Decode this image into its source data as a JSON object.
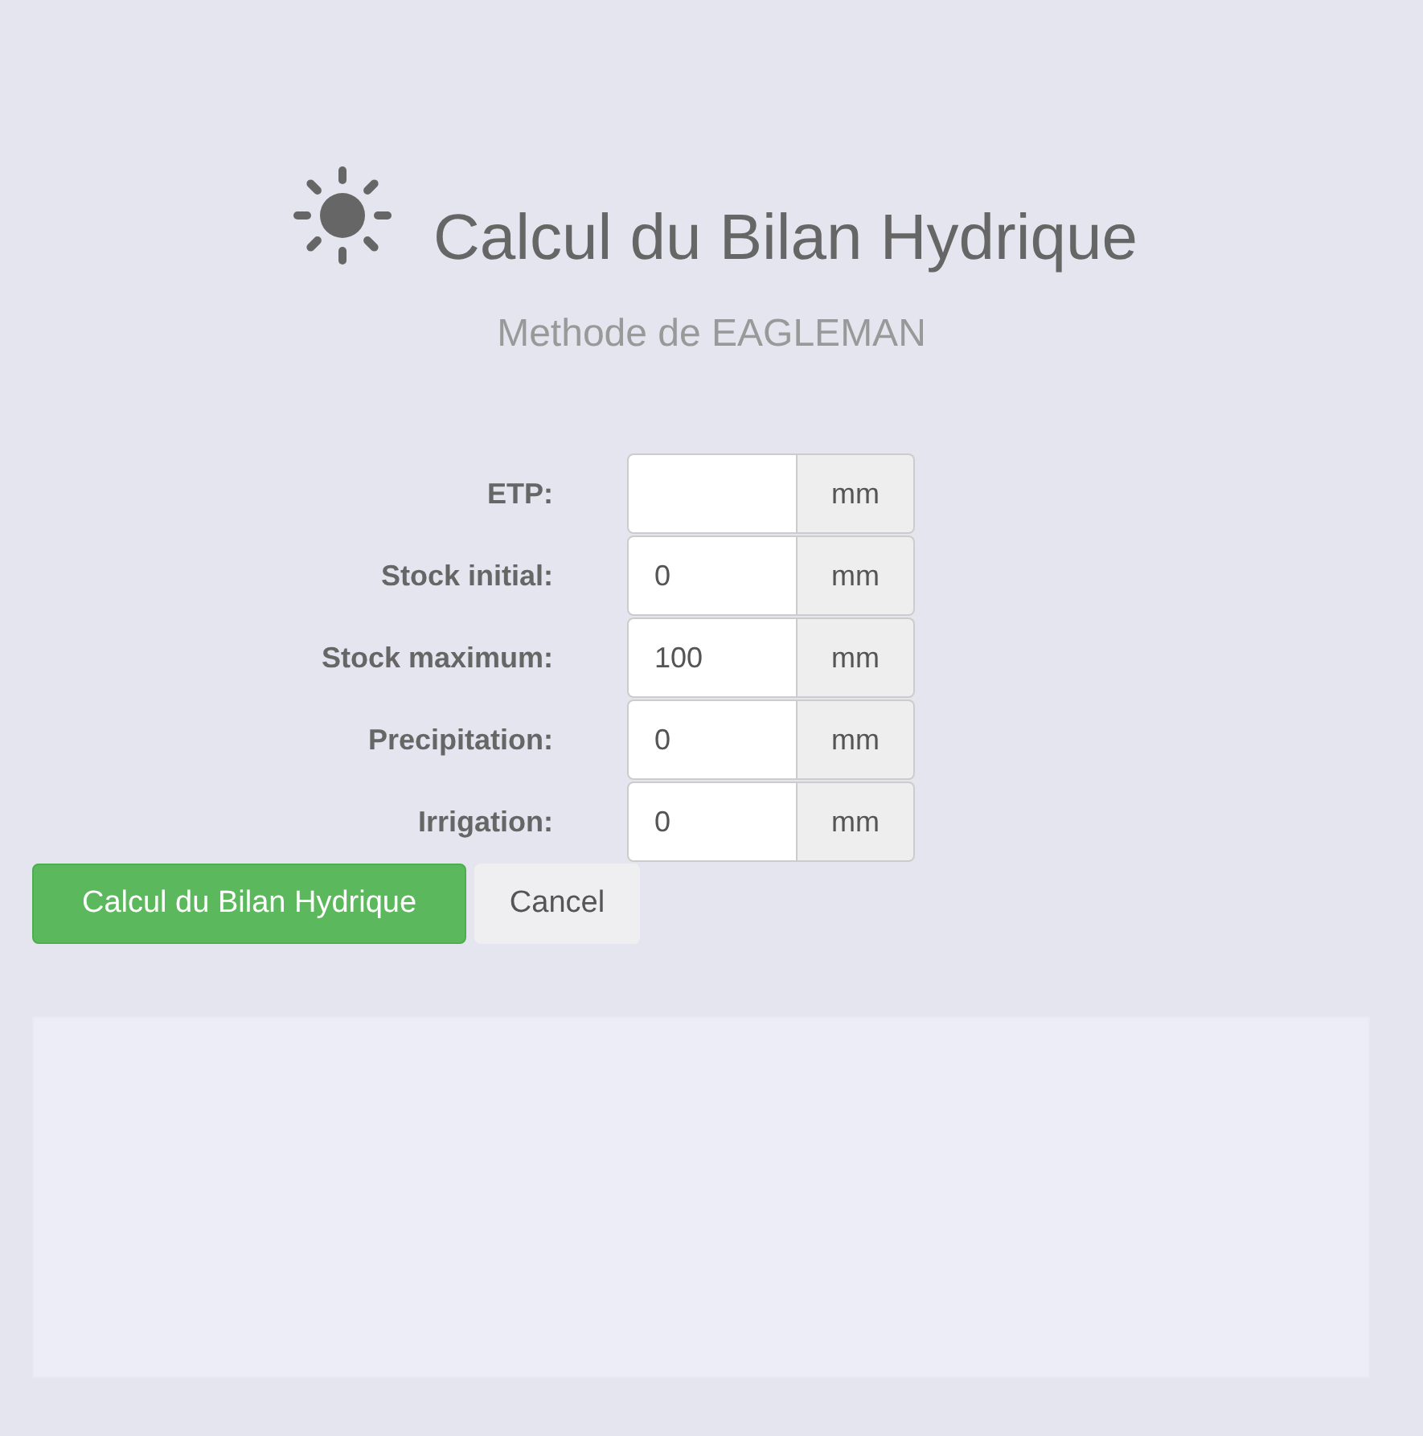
{
  "header": {
    "title": "Calcul du Bilan Hydrique",
    "subtitle": "Methode de EAGLEMAN"
  },
  "fields": [
    {
      "label": "ETP:",
      "unit": "mm"
    },
    {
      "label": "Stock initial:",
      "value": "0",
      "unit": "mm"
    },
    {
      "label": "Stock maximum:",
      "value": "100",
      "unit": "mm"
    },
    {
      "label": "Precipitation:",
      "value": "0",
      "unit": "mm"
    },
    {
      "label": "Irrigation:",
      "value": "0",
      "unit": "mm"
    }
  ],
  "buttons": [
    {
      "label": "Calcul du Bilan Hydrique",
      "kind": "primary"
    },
    {
      "label": "Cancel",
      "kind": "default"
    }
  ]
}
